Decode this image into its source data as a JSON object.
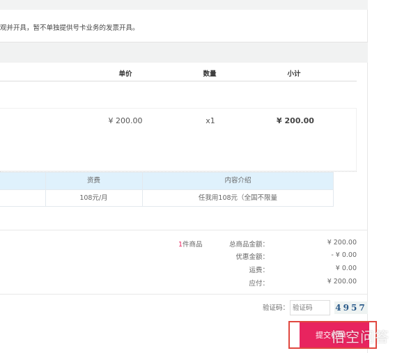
{
  "notice": "观并开具，暂不单独提供号卡业务的发票开具。",
  "table_headers": {
    "unit_price": "单价",
    "quantity": "数量",
    "subtotal": "小计"
  },
  "item": {
    "unit_price": "¥ 200.00",
    "quantity": "x1",
    "subtotal": "¥ 200.00"
  },
  "plan_table": {
    "headers": [
      "",
      "资费",
      "内容介绍"
    ],
    "row": [
      "",
      "108元/月",
      "任我用108元（全国不限量"
    ]
  },
  "summary": {
    "count_num": "1",
    "count_label": "件商品",
    "rows": [
      {
        "label": "总商品金额：",
        "value": "¥ 200.00"
      },
      {
        "label": "优惠金额：",
        "value": "- ¥ 0.00"
      },
      {
        "label": "运费：",
        "value": "¥ 0.00"
      },
      {
        "label": "应付：",
        "value": "¥ 200.00"
      }
    ]
  },
  "captcha": {
    "label": "验证码：",
    "placeholder": "验证码",
    "code": "4957"
  },
  "submit_label": "提交订单",
  "watermark": "悟空问答",
  "colors": {
    "accent": "#e8245f",
    "highlight_border": "#e0473f",
    "table_header_bg": "#dff1fc"
  }
}
